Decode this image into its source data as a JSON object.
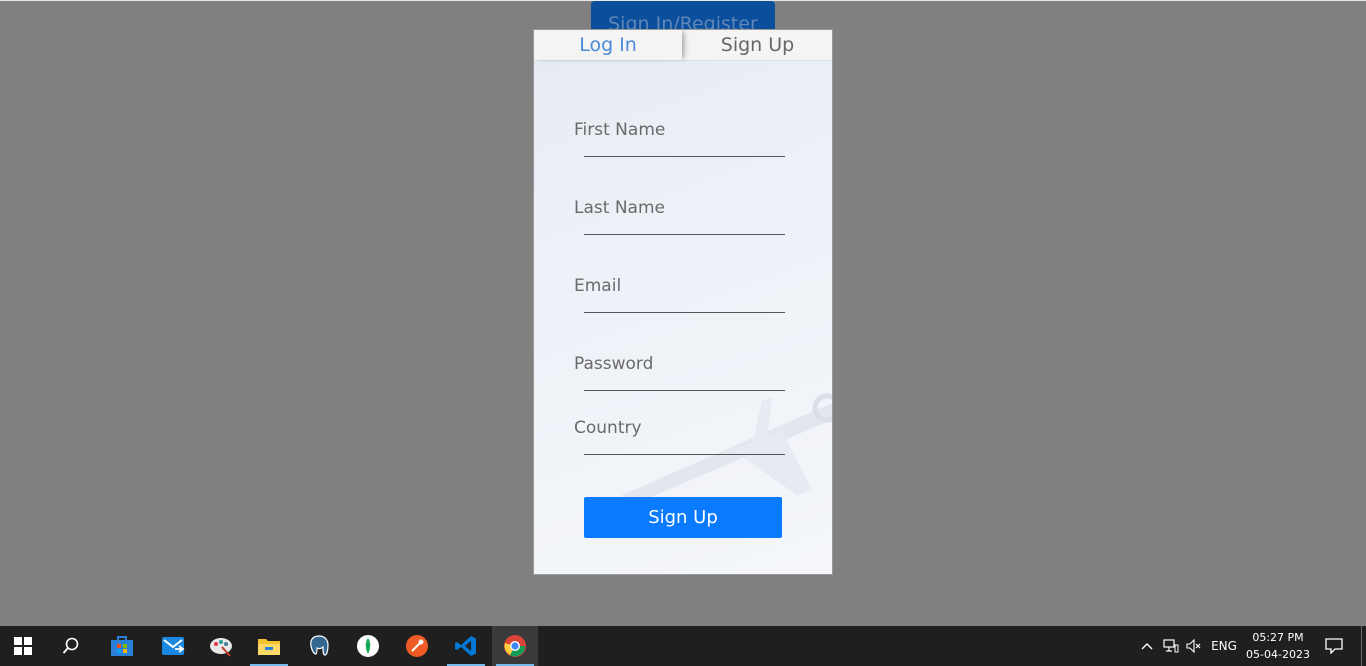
{
  "background_button": {
    "label": "Sign In/Register"
  },
  "modal": {
    "tabs": [
      {
        "label": "Log In",
        "active": true
      },
      {
        "label": "Sign Up",
        "active": false
      }
    ],
    "fields": [
      {
        "label": "First Name",
        "value": ""
      },
      {
        "label": "Last Name",
        "value": ""
      },
      {
        "label": "Email",
        "value": ""
      },
      {
        "label": "Password",
        "value": ""
      },
      {
        "label": "Country",
        "value": ""
      }
    ],
    "submit_label": "Sign Up",
    "accent_color": "#0a7bff",
    "active_tab_color": "#4a8ad8"
  },
  "taskbar": {
    "apps": [
      {
        "name": "start-icon"
      },
      {
        "name": "search-icon"
      },
      {
        "name": "store-icon"
      },
      {
        "name": "email-app-icon"
      },
      {
        "name": "paint-app-icon"
      },
      {
        "name": "file-explorer-icon"
      },
      {
        "name": "postgresql-icon"
      },
      {
        "name": "mongodb-icon"
      },
      {
        "name": "postman-icon"
      },
      {
        "name": "vscode-icon"
      },
      {
        "name": "chrome-icon"
      }
    ],
    "tray": {
      "language": "ENG",
      "time": "05:27 PM",
      "date": "05-04-2023"
    }
  }
}
